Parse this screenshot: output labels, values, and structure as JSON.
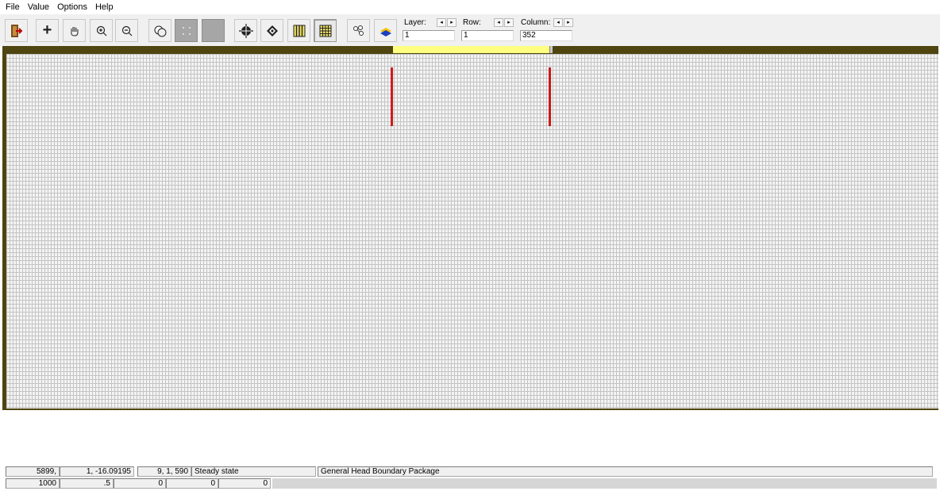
{
  "menu": {
    "items": [
      "File",
      "Value",
      "Options",
      "Help"
    ]
  },
  "toolbar": {
    "icons": {
      "exit": "exit-door-icon",
      "add": "plus-icon",
      "pan": "hand-pan-icon",
      "zoom_in": "zoom-in-icon",
      "zoom_out": "zoom-out-icon",
      "select_cells": "select-cells-icon",
      "dots": "dotted-grid-icon",
      "blank": "blank-gray-icon",
      "crosshair": "crosshair-globe-icon",
      "diamond": "diamond-icon",
      "columns": "column-grid-icon",
      "rows": "row-grid-icon",
      "nodes": "nodes-icon",
      "layer3d": "3d-layer-icon"
    },
    "layer": {
      "label": "Layer:",
      "value": "1"
    },
    "row": {
      "label": "Row:",
      "value": "1"
    },
    "column": {
      "label": "Column:",
      "value": "352"
    },
    "spin_left": "◂",
    "spin_right": "▸"
  },
  "grid": {
    "selection_color": "#ffff80",
    "border_color": "#4e4510",
    "marker_color": "#cc1a1a"
  },
  "status": {
    "row1": {
      "col1": "5899,",
      "col2": "1, -16.09195",
      "col3": "9, 1, 590",
      "col4": "Steady state",
      "col5": "General Head Boundary Package"
    },
    "row2": {
      "col1": "1000",
      "col2": ".5",
      "col3": "0",
      "col4": "0",
      "col5": "0"
    }
  }
}
